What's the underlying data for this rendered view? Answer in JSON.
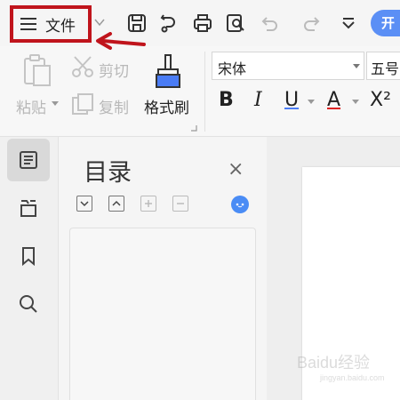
{
  "topbar": {
    "file_menu_label": "文件",
    "quick_access": [
      "save-icon",
      "undo-history-icon",
      "print-icon",
      "print-preview-icon",
      "undo-icon",
      "redo-icon",
      "customize-icon"
    ],
    "open_button_label": "开"
  },
  "ribbon": {
    "paste_label": "粘贴",
    "cut_label": "剪切",
    "copy_label": "复制",
    "format_painter_label": "格式刷",
    "font_name": "宋体",
    "font_size": "五号",
    "format_buttons": {
      "bold": "B",
      "italic": "I",
      "underline": "U",
      "font_color": "A",
      "superscript": "X²"
    }
  },
  "sidebar": {
    "items": [
      "toc-icon",
      "navigation-icon",
      "bookmark-icon",
      "search-icon"
    ],
    "active_index": 0
  },
  "toc": {
    "title": "目录",
    "close_symbol": "×"
  },
  "watermark": {
    "text": "Baidu经验",
    "sub": "jingyan.baidu.com"
  },
  "colors": {
    "highlight": "#c0141c",
    "accent": "#5b8ff5",
    "settings": "#4a8cf5"
  }
}
